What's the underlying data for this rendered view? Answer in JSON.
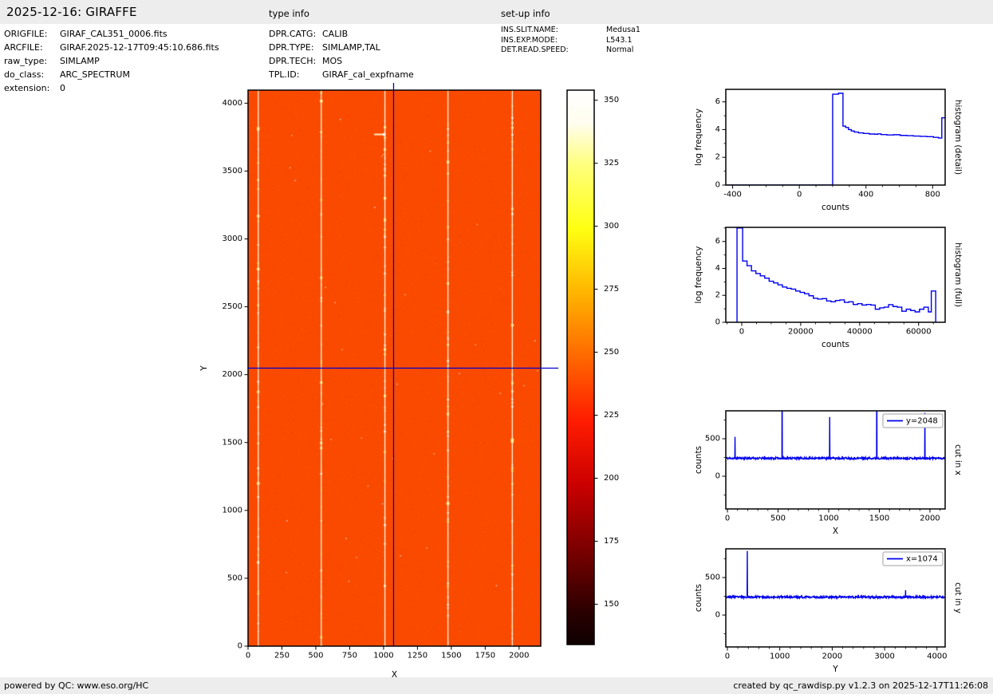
{
  "header": {
    "title": "2025-12-16: GIRAFFE",
    "type_info_title": "type info",
    "setup_info_title": "set-up info"
  },
  "file_info": {
    "rows": [
      {
        "label": "ORIGFILE:",
        "value": "GIRAF_CAL351_0006.fits"
      },
      {
        "label": "ARCFILE:",
        "value": "GIRAF.2025-12-17T09:45:10.686.fits"
      },
      {
        "label": "raw_type:",
        "value": "SIMLAMP"
      },
      {
        "label": "do_class:",
        "value": "ARC_SPECTRUM"
      },
      {
        "label": "extension:",
        "value": "0"
      }
    ]
  },
  "type_info": {
    "rows": [
      {
        "label": "DPR.CATG:",
        "value": "CALIB"
      },
      {
        "label": "DPR.TYPE:",
        "value": "SIMLAMP,TAL"
      },
      {
        "label": "DPR.TECH:",
        "value": "MOS"
      },
      {
        "label": "TPL.ID:",
        "value": "GIRAF_cal_expfname"
      }
    ]
  },
  "setup_info": {
    "rows": [
      {
        "label": "INS.SLIT.NAME:",
        "value": "Medusa1"
      },
      {
        "label": "INS.EXP.MODE:",
        "value": "L543.1"
      },
      {
        "label": "DET.READ.SPEED:",
        "value": "Normal"
      }
    ]
  },
  "footer": {
    "left": "powered by QC: www.eso.org/HC",
    "right": "created by qc_rawdisp.py v1.2.3 on 2025-12-17T11:26:08"
  },
  "colors": {
    "curve_blue": "#0000ee",
    "crosshair_blue": "#0000cc",
    "image_base_orange": "#fa4a00",
    "emission_line": "#fff6dc",
    "bar_background": "#ededed"
  },
  "chart_data": [
    {
      "id": "main_image",
      "type": "heatmap",
      "xlabel": "X",
      "ylabel": "Y",
      "xlim": [
        0,
        2160
      ],
      "ylim": [
        0,
        4096
      ],
      "xticks": [
        0,
        250,
        500,
        750,
        1000,
        1250,
        1500,
        1750,
        2000
      ],
      "yticks": [
        0,
        500,
        1000,
        1500,
        2000,
        2500,
        3000,
        3500,
        4000
      ],
      "background_counts": 240,
      "emission_line_columns_x": [
        75,
        540,
        1010,
        1475,
        1950
      ],
      "horizontal_streak": {
        "x_range": [
          930,
          1010
        ],
        "y": 3770
      },
      "crosshair": {
        "x": 1074,
        "y": 2048
      },
      "colormap": "hot"
    },
    {
      "id": "colorbar",
      "type": "colorbar",
      "vmin": 134,
      "vmax": 354,
      "ticks": [
        150,
        175,
        200,
        225,
        250,
        275,
        300,
        325,
        350
      ],
      "colormap": "hot",
      "gradient_stops": [
        {
          "pos": 0,
          "color": "#ffffff"
        },
        {
          "pos": 6,
          "color": "#fffdee"
        },
        {
          "pos": 13.4,
          "color": "#ffff7d"
        },
        {
          "pos": 25,
          "color": "#ffff12"
        },
        {
          "pos": 36.6,
          "color": "#ffb400"
        },
        {
          "pos": 48.1,
          "color": "#ff6800"
        },
        {
          "pos": 59.7,
          "color": "#ff1c00"
        },
        {
          "pos": 71.3,
          "color": "#ca0000"
        },
        {
          "pos": 82.9,
          "color": "#7b0000"
        },
        {
          "pos": 94.4,
          "color": "#290000"
        },
        {
          "pos": 100,
          "color": "#0e0000"
        }
      ]
    },
    {
      "id": "hist_detail",
      "type": "line",
      "xlabel": "counts",
      "ylabel": "log frequency",
      "right_label": "histogram (detail)",
      "xlim": [
        -441,
        875
      ],
      "ylim": [
        0,
        6.9
      ],
      "xticks": [
        -400,
        0,
        400,
        800
      ],
      "xminor_step": 100,
      "yticks": [
        0,
        2,
        4,
        6
      ],
      "yminor_step": 1,
      "points": [
        [
          -441,
          0
        ],
        [
          200,
          0
        ],
        [
          200,
          6.55
        ],
        [
          235,
          6.55
        ],
        [
          235,
          6.62
        ],
        [
          262,
          6.62
        ],
        [
          262,
          4.25
        ],
        [
          278,
          4.25
        ],
        [
          278,
          4.15
        ],
        [
          295,
          4.15
        ],
        [
          295,
          4.0
        ],
        [
          312,
          4.0
        ],
        [
          312,
          3.9
        ],
        [
          330,
          3.9
        ],
        [
          330,
          3.82
        ],
        [
          355,
          3.82
        ],
        [
          355,
          3.76
        ],
        [
          385,
          3.76
        ],
        [
          385,
          3.72
        ],
        [
          420,
          3.72
        ],
        [
          420,
          3.68
        ],
        [
          455,
          3.68
        ],
        [
          455,
          3.66
        ],
        [
          470,
          3.66
        ],
        [
          470,
          3.69
        ],
        [
          490,
          3.69
        ],
        [
          490,
          3.64
        ],
        [
          525,
          3.64
        ],
        [
          525,
          3.61
        ],
        [
          565,
          3.61
        ],
        [
          565,
          3.63
        ],
        [
          605,
          3.63
        ],
        [
          605,
          3.58
        ],
        [
          645,
          3.58
        ],
        [
          645,
          3.56
        ],
        [
          685,
          3.56
        ],
        [
          685,
          3.53
        ],
        [
          725,
          3.53
        ],
        [
          725,
          3.51
        ],
        [
          765,
          3.51
        ],
        [
          765,
          3.49
        ],
        [
          805,
          3.49
        ],
        [
          805,
          3.44
        ],
        [
          835,
          3.44
        ],
        [
          835,
          3.39
        ],
        [
          855,
          3.39
        ],
        [
          855,
          4.85
        ],
        [
          875,
          4.85
        ]
      ]
    },
    {
      "id": "hist_full",
      "type": "line",
      "xlabel": "counts",
      "ylabel": "log frequency",
      "right_label": "histogram (full)",
      "xlim": [
        -5400,
        69000
      ],
      "ylim": [
        0,
        7.05
      ],
      "xticks": [
        0,
        20000,
        40000,
        60000
      ],
      "xminor_step": 5000,
      "yticks": [
        0,
        2,
        4,
        6
      ],
      "yminor_step": 1,
      "points": [
        [
          -1600,
          0
        ],
        [
          -1600,
          7.0
        ],
        [
          300,
          7.0
        ],
        [
          300,
          4.55
        ],
        [
          1800,
          4.55
        ],
        [
          1800,
          4.2
        ],
        [
          3300,
          4.2
        ],
        [
          3300,
          3.82
        ],
        [
          4800,
          3.82
        ],
        [
          4800,
          3.62
        ],
        [
          6300,
          3.62
        ],
        [
          6300,
          3.45
        ],
        [
          7800,
          3.45
        ],
        [
          7800,
          3.28
        ],
        [
          9300,
          3.28
        ],
        [
          9300,
          3.05
        ],
        [
          10800,
          3.05
        ],
        [
          10800,
          2.92
        ],
        [
          12300,
          2.92
        ],
        [
          12300,
          2.78
        ],
        [
          13800,
          2.78
        ],
        [
          13800,
          2.62
        ],
        [
          15300,
          2.62
        ],
        [
          15300,
          2.52
        ],
        [
          16800,
          2.52
        ],
        [
          16800,
          2.46
        ],
        [
          18300,
          2.46
        ],
        [
          18300,
          2.32
        ],
        [
          19800,
          2.32
        ],
        [
          19800,
          2.22
        ],
        [
          21300,
          2.22
        ],
        [
          21300,
          2.12
        ],
        [
          22800,
          2.12
        ],
        [
          22800,
          1.97
        ],
        [
          24300,
          1.97
        ],
        [
          24300,
          1.78
        ],
        [
          25800,
          1.78
        ],
        [
          25800,
          1.72
        ],
        [
          27300,
          1.72
        ],
        [
          27300,
          1.76
        ],
        [
          28800,
          1.76
        ],
        [
          28800,
          1.58
        ],
        [
          30300,
          1.58
        ],
        [
          30300,
          1.52
        ],
        [
          31800,
          1.52
        ],
        [
          31800,
          1.62
        ],
        [
          33300,
          1.62
        ],
        [
          33300,
          1.66
        ],
        [
          34800,
          1.66
        ],
        [
          34800,
          1.48
        ],
        [
          36300,
          1.48
        ],
        [
          36300,
          1.52
        ],
        [
          37800,
          1.52
        ],
        [
          37800,
          1.32
        ],
        [
          39300,
          1.32
        ],
        [
          39300,
          1.38
        ],
        [
          40800,
          1.38
        ],
        [
          40800,
          1.28
        ],
        [
          42300,
          1.28
        ],
        [
          42300,
          1.32
        ],
        [
          43800,
          1.32
        ],
        [
          43800,
          1.28
        ],
        [
          45300,
          1.28
        ],
        [
          45300,
          0.97
        ],
        [
          46800,
          0.97
        ],
        [
          46800,
          1.07
        ],
        [
          48300,
          1.07
        ],
        [
          48300,
          1.12
        ],
        [
          49800,
          1.12
        ],
        [
          49800,
          1.31
        ],
        [
          51300,
          1.31
        ],
        [
          51300,
          1.17
        ],
        [
          52800,
          1.17
        ],
        [
          52800,
          1.12
        ],
        [
          54300,
          1.12
        ],
        [
          54300,
          0.82
        ],
        [
          55800,
          0.82
        ],
        [
          55800,
          0.97
        ],
        [
          57300,
          0.97
        ],
        [
          57300,
          0.87
        ],
        [
          58800,
          0.87
        ],
        [
          58800,
          0.77
        ],
        [
          60300,
          0.77
        ],
        [
          60300,
          0.97
        ],
        [
          61800,
          0.97
        ],
        [
          61800,
          1.12
        ],
        [
          63300,
          1.12
        ],
        [
          63300,
          0.77
        ],
        [
          64300,
          0.77
        ],
        [
          64300,
          2.32
        ],
        [
          65800,
          2.32
        ],
        [
          65800,
          0
        ]
      ]
    },
    {
      "id": "cut_x",
      "type": "line",
      "xlabel": "X",
      "ylabel": "counts",
      "right_label": "cut in x",
      "legend_label": "y=2048",
      "xlim": [
        -16,
        2150
      ],
      "ylim": [
        -436,
        872
      ],
      "xticks": [
        0,
        500,
        1000,
        1500,
        2000
      ],
      "xminor_step": 100,
      "yticks": [
        0,
        500
      ],
      "yminor_step": 250,
      "baseline": 240,
      "noise_amplitude": 13,
      "peaks": [
        [
          75,
          525
        ],
        [
          540,
          1600
        ],
        [
          1010,
          790
        ],
        [
          1475,
          1600
        ],
        [
          1950,
          845
        ]
      ]
    },
    {
      "id": "cut_y",
      "type": "line",
      "xlabel": "Y",
      "ylabel": "counts",
      "right_label": "cut in y",
      "legend_label": "x=1074",
      "xlim": [
        -30,
        4155
      ],
      "ylim": [
        -425,
        883
      ],
      "xticks": [
        0,
        1000,
        2000,
        3000,
        4000
      ],
      "xminor_step": 200,
      "yticks": [
        0,
        500
      ],
      "yminor_step": 250,
      "baseline": 240,
      "noise_amplitude": 13,
      "peaks": [
        [
          380,
          855
        ],
        [
          3400,
          332
        ]
      ]
    }
  ]
}
